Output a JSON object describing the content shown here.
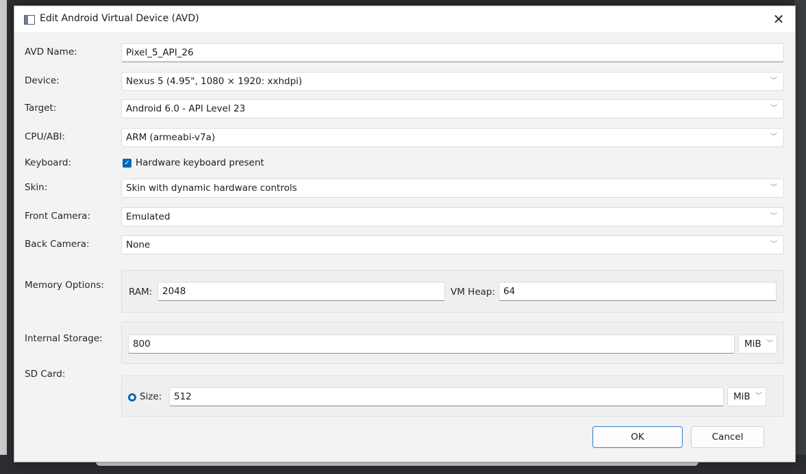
{
  "window": {
    "title": "Edit Android Virtual Device (AVD)",
    "close_glyph": "✕"
  },
  "form": {
    "avd_name": {
      "label": "AVD Name:",
      "value": "Pixel_5_API_26"
    },
    "device": {
      "label": "Device:",
      "value": "Nexus 5 (4.95\", 1080 × 1920: xxhdpi)"
    },
    "target": {
      "label": "Target:",
      "value": "Android 6.0 - API Level 23"
    },
    "cpu_abi": {
      "label": "CPU/ABI:",
      "value": "ARM (armeabi-v7a)"
    },
    "keyboard": {
      "label": "Keyboard:",
      "checkbox_label": "Hardware keyboard present",
      "checked": true
    },
    "skin": {
      "label": "Skin:",
      "value": "Skin with dynamic hardware controls"
    },
    "front_camera": {
      "label": "Front Camera:",
      "value": "Emulated"
    },
    "back_camera": {
      "label": "Back Camera:",
      "value": "None"
    },
    "memory": {
      "label": "Memory Options:",
      "ram_label": "RAM:",
      "ram_value": "2048",
      "vm_heap_label": "VM Heap:",
      "vm_heap_value": "64"
    },
    "internal_storage": {
      "label": "Internal Storage:",
      "value": "800",
      "unit": "MiB"
    },
    "sd_card": {
      "label": "SD Card:",
      "size_label": "Size:",
      "size_value": "512",
      "unit": "MiB",
      "size_selected": true
    }
  },
  "buttons": {
    "ok": "OK",
    "cancel": "Cancel"
  },
  "icons": {
    "chevron": "chevron-down-icon",
    "chevron_glyph": "﹀"
  },
  "colors": {
    "accent": "#0067c0",
    "dialog_bg": "#f3f3f3",
    "backdrop": "#2b2d30"
  }
}
